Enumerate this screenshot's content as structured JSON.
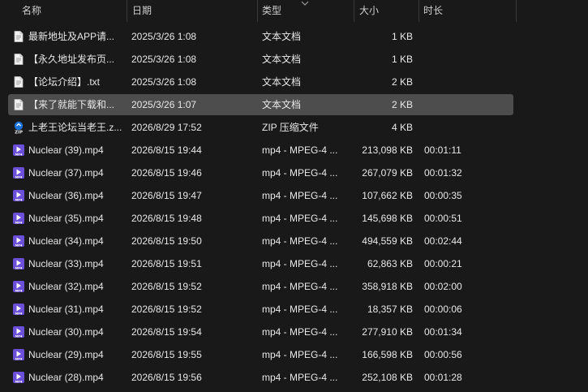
{
  "columns": {
    "name": "名称",
    "date": "日期",
    "type": "类型",
    "size": "大小",
    "duration": "时长"
  },
  "icons": {
    "text_file": "document-icon",
    "zip_file": "zip-icon",
    "video_file": "mp4-video-icon",
    "sort": "chevron-down-icon"
  },
  "colors": {
    "background": "#191919",
    "selected_row": "#4d4d4d",
    "zip_accent": "#1a73d9",
    "video_accent": "#6a4fd8"
  },
  "files": [
    {
      "name": "最新地址及APP请...",
      "date": "2025/3/26 1:08",
      "type": "文本文档",
      "size": "1 KB",
      "duration": "",
      "kind": "text",
      "selected": false
    },
    {
      "name": "【永久地址发布页...",
      "date": "2025/3/26 1:08",
      "type": "文本文档",
      "size": "1 KB",
      "duration": "",
      "kind": "text",
      "selected": false
    },
    {
      "name": "【论坛介绍】.txt",
      "date": "2025/3/26 1:08",
      "type": "文本文档",
      "size": "2 KB",
      "duration": "",
      "kind": "text",
      "selected": false
    },
    {
      "name": "【来了就能下载和...",
      "date": "2025/3/26 1:07",
      "type": "文本文档",
      "size": "2 KB",
      "duration": "",
      "kind": "text",
      "selected": true
    },
    {
      "name": "上老王论坛当老王.z...",
      "date": "2026/8/29 17:52",
      "type": "ZIP 压缩文件",
      "size": "4 KB",
      "duration": "",
      "kind": "zip",
      "selected": false
    },
    {
      "name": "Nuclear (39).mp4",
      "date": "2026/8/15 19:44",
      "type": "mp4 - MPEG-4 ...",
      "size": "213,098 KB",
      "duration": "00:01:11",
      "kind": "video",
      "selected": false
    },
    {
      "name": "Nuclear (37).mp4",
      "date": "2026/8/15 19:46",
      "type": "mp4 - MPEG-4 ...",
      "size": "267,079 KB",
      "duration": "00:01:32",
      "kind": "video",
      "selected": false
    },
    {
      "name": "Nuclear (36).mp4",
      "date": "2026/8/15 19:47",
      "type": "mp4 - MPEG-4 ...",
      "size": "107,662 KB",
      "duration": "00:00:35",
      "kind": "video",
      "selected": false
    },
    {
      "name": "Nuclear (35).mp4",
      "date": "2026/8/15 19:48",
      "type": "mp4 - MPEG-4 ...",
      "size": "145,698 KB",
      "duration": "00:00:51",
      "kind": "video",
      "selected": false
    },
    {
      "name": "Nuclear (34).mp4",
      "date": "2026/8/15 19:50",
      "type": "mp4 - MPEG-4 ...",
      "size": "494,559 KB",
      "duration": "00:02:44",
      "kind": "video",
      "selected": false
    },
    {
      "name": "Nuclear (33).mp4",
      "date": "2026/8/15 19:51",
      "type": "mp4 - MPEG-4 ...",
      "size": "62,863 KB",
      "duration": "00:00:21",
      "kind": "video",
      "selected": false
    },
    {
      "name": "Nuclear (32).mp4",
      "date": "2026/8/15 19:52",
      "type": "mp4 - MPEG-4 ...",
      "size": "358,918 KB",
      "duration": "00:02:00",
      "kind": "video",
      "selected": false
    },
    {
      "name": "Nuclear (31).mp4",
      "date": "2026/8/15 19:52",
      "type": "mp4 - MPEG-4 ...",
      "size": "18,357 KB",
      "duration": "00:00:06",
      "kind": "video",
      "selected": false
    },
    {
      "name": "Nuclear (30).mp4",
      "date": "2026/8/15 19:54",
      "type": "mp4 - MPEG-4 ...",
      "size": "277,910 KB",
      "duration": "00:01:34",
      "kind": "video",
      "selected": false
    },
    {
      "name": "Nuclear (29).mp4",
      "date": "2026/8/15 19:55",
      "type": "mp4 - MPEG-4 ...",
      "size": "166,598 KB",
      "duration": "00:00:56",
      "kind": "video",
      "selected": false
    },
    {
      "name": "Nuclear (28).mp4",
      "date": "2026/8/15 19:56",
      "type": "mp4 - MPEG-4 ...",
      "size": "252,108 KB",
      "duration": "00:01:28",
      "kind": "video",
      "selected": false
    }
  ]
}
